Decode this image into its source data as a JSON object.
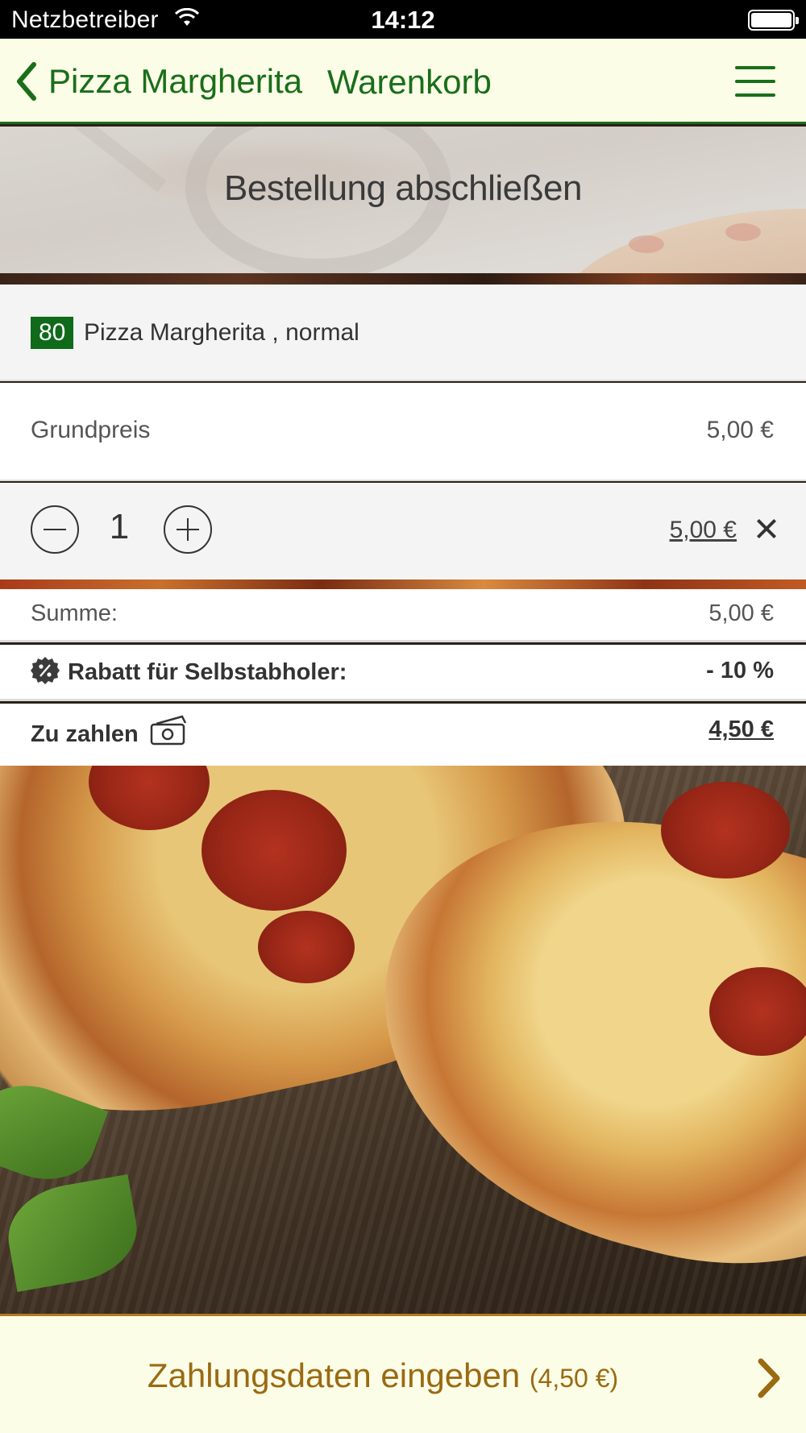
{
  "status_bar": {
    "carrier": "Netzbetreiber",
    "time": "14:12"
  },
  "nav": {
    "back_label": "Pizza Margherita",
    "title": "Warenkorb"
  },
  "hero": {
    "title": "Bestellung abschließen"
  },
  "item": {
    "number": "80",
    "name": "Pizza Margherita , normal"
  },
  "base_price": {
    "label": "Grundpreis",
    "value": "5,00 €"
  },
  "quantity": {
    "value": "1",
    "line_total": "5,00 €"
  },
  "summary": {
    "sum_label": "Summe:",
    "sum_value": "5,00 €",
    "discount_label": "Rabatt für Selbstabholer:",
    "discount_value": "- 10 %",
    "pay_label": "Zu zahlen",
    "pay_value": "4,50 €"
  },
  "cta": {
    "label": "Zahlungsdaten eingeben",
    "amount": "(4,50 €)"
  },
  "colors": {
    "brand_green": "#1a6e1a",
    "cta_gold": "#9a6a12",
    "bar_bg": "#fbfde7"
  }
}
